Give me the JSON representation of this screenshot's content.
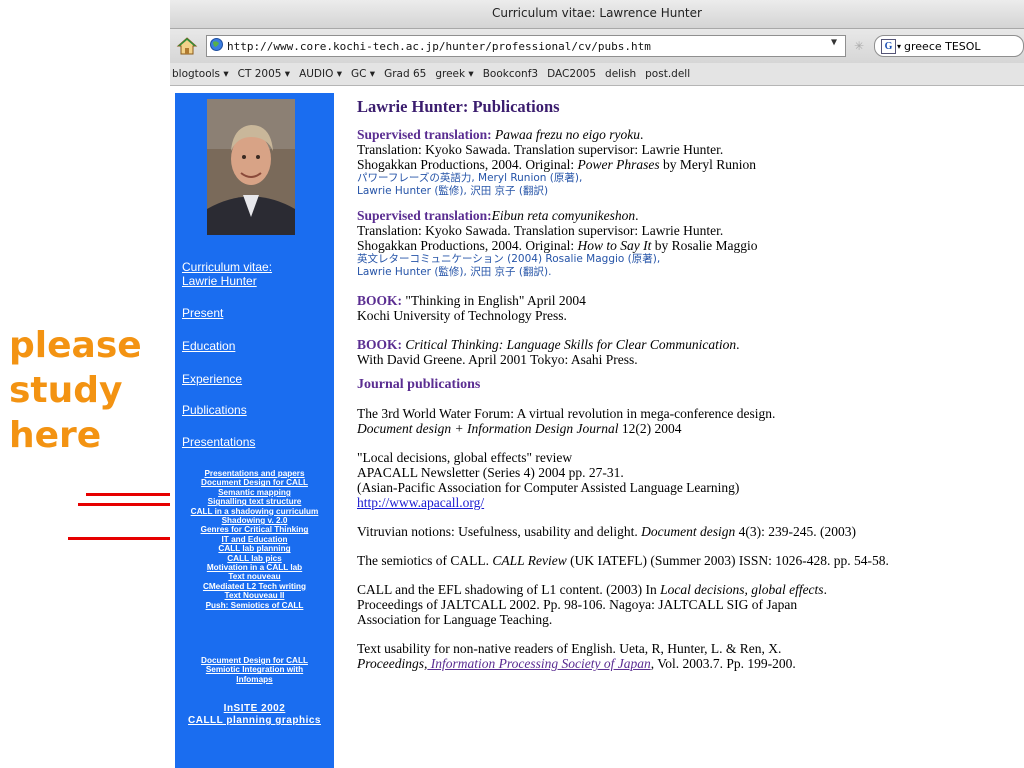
{
  "window": {
    "title": "Curriculum vitae: Lawrence Hunter"
  },
  "navbar": {
    "url": "http://www.core.kochi-tech.ac.jp/hunter/professional/cv/pubs.htm",
    "search_value": "greece TESOL"
  },
  "bookmarks": [
    "blogtools ▾",
    "CT 2005 ▾",
    "AUDIO ▾",
    "GC ▾",
    "Grad 65",
    "greek ▾",
    "Bookconf3",
    "DAC2005",
    "delish",
    "post.dell"
  ],
  "sidebar": {
    "cv_line1": "Curriculum vitae:",
    "cv_line2": "Lawrie Hunter",
    "links": [
      "Present",
      "Education",
      "Experience",
      "Publications",
      "Presentations"
    ],
    "small_links_1": [
      "Presentations and papers",
      "Document Design for CALL",
      "Semantic mapping",
      "Signalling text structure",
      "CALL in a shadowing curriculum",
      "Shadowing v. 2.0",
      "Genres for Critical Thinking",
      "IT and Education",
      "CALL lab planning",
      "CALL lab pics",
      "Motivation in a CALL lab",
      "Text nouveau",
      "CMediated L2 Tech writing",
      "Text Nouveau II",
      "Push: Semiotics of CALL"
    ],
    "small_links_2": [
      "Document Design for CALL",
      "Semiotic Integration with",
      "Infomaps"
    ],
    "insite": "InSITE 2002",
    "calll": "CALLL planning graphics"
  },
  "main": {
    "title": "Lawrie Hunter: Publications",
    "entry1": {
      "label": "Supervised translation:",
      "title": "Pawaa frezu no eigo ryoku",
      "line2": "Translation: Kyoko Sawada. Translation supervisor: Lawrie Hunter.",
      "line3_pre": "Shogakkan Productions, 2004. Original: ",
      "line3_title": "Power Phrases",
      "line3_post": " by Meryl Runion",
      "jp1": "パワーフレーズの英語力, Meryl Runion (原著),",
      "jp2": "Lawrie Hunter (監修), 沢田 京子 (翻訳)"
    },
    "entry2": {
      "label": "Supervised translation:",
      "title": "Eibun reta comyunikeshon",
      "line2": "Translation: Kyoko Sawada. Translation supervisor: Lawrie Hunter.",
      "line3_pre": "Shogakkan Productions, 2004. Original: ",
      "line3_title": "How to Say It",
      "line3_post": " by Rosalie Maggio",
      "jp1": "英文レターコミュニケーション (2004)  Rosalie Maggio (原著),",
      "jp2": "Lawrie Hunter (監修), 沢田 京子 (翻訳)."
    },
    "entry3": {
      "label": "BOOK:",
      "line1": " \"Thinking in English\" April 2004",
      "line2": "Kochi University of Technology Press."
    },
    "entry4": {
      "label": "BOOK:",
      "title": "Critical Thinking: Language Skills for Clear Communication",
      "line2": "With David Greene. April 2001 Tokyo: Asahi Press."
    },
    "journal_heading": "Journal publications",
    "j1": {
      "line1": "The 3rd World Water Forum: A virtual revolution in mega-conference design.",
      "journal": "Document design + Information Design Journal",
      "rest": " 12(2) 2004"
    },
    "j2": {
      "line1": "\"Local decisions, global effects\" review",
      "line2": "APACALL Newsletter (Series 4) 2004 pp. 27-31.",
      "line3": "(Asian-Pacific Association for Computer Assisted Language Learning)",
      "link": "http://www.apacall.org/"
    },
    "j3": {
      "pre": "Vitruvian notions: Usefulness, usability and delight. ",
      "journal": "Document design",
      "post": " 4(3): 239-245. (2003)"
    },
    "j4": {
      "pre": "The semiotics of CALL. ",
      "journal": "CALL Review",
      "post": " (UK IATEFL) (Summer 2003) ISSN: 1026-428. pp. 54-58."
    },
    "j5": {
      "pre": "CALL and the EFL shadowing of L1 content. (2003) In ",
      "book": "Local decisions, global effects",
      "post": ".",
      "line2": "Proceedings of JALTCALL 2002. Pp. 98-106. Nagoya: JALTCALL SIG of Japan",
      "line3": "Association for Language Teaching."
    },
    "j6": {
      "line1": "Text usability for non-native readers of English. Ueta, R, Hunter, L. & Ren, X.",
      "proc": "Proceedings,",
      "link": " Information Processing Society of Japan",
      "post": ", Vol. 2003.7. Pp. 199-200."
    }
  },
  "overlay": {
    "line1": "please",
    "line2": "study",
    "line3": "here"
  },
  "colors": {
    "sidebar": "#1a6df0",
    "heading": "#5a2d91",
    "overlay": "#f39312",
    "arrow": "#e60000"
  }
}
